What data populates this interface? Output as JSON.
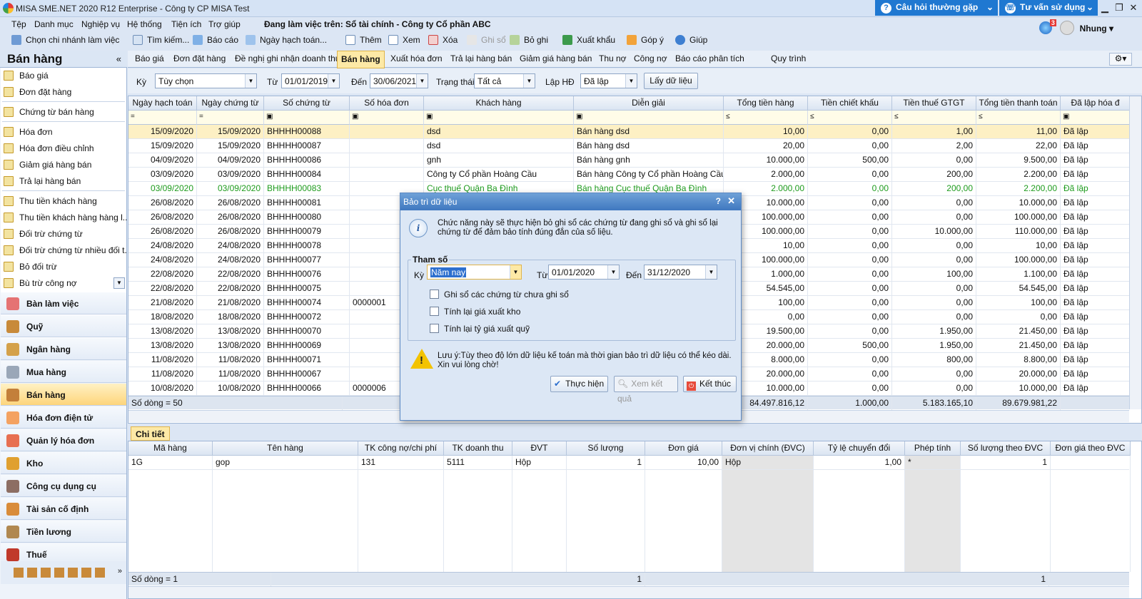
{
  "window": {
    "title": "MISA SME.NET 2020 R12 Enterprise - Công ty CP MISA Test",
    "faq": "Câu hỏi thường gặp",
    "consult": "Tư vấn sử dụng"
  },
  "menu": [
    "Tệp",
    "Danh mục",
    "Nghiệp vụ",
    "Hệ thống",
    "Tiện ích",
    "Trợ giúp"
  ],
  "working_on": "Đang làm việc trên: Sổ tài chính - Công ty Cổ phần ABC",
  "toolbar": {
    "branch": "Chọn chi nhánh làm việc",
    "search": "Tìm kiếm...",
    "report": "Báo cáo",
    "post_date": "Ngày hạch toán...",
    "add": "Thêm",
    "view": "Xem",
    "delete": "Xóa",
    "post": "Ghi sổ",
    "unpost": "Bỏ ghi",
    "export": "Xuất khẩu",
    "feedback": "Góp ý",
    "help": "Giúp"
  },
  "user": {
    "name": "Nhung",
    "badge": "3"
  },
  "left": {
    "title": "Bán hàng",
    "items": [
      "Báo giá",
      "Đơn đặt hàng",
      "Chứng từ bán hàng",
      "Hóa đơn",
      "Hóa đơn điều chỉnh",
      "Giảm giá hàng bán",
      "Trả lại hàng bán",
      "Thu tiền khách hàng",
      "Thu tiền khách hàng hàng l...",
      "Đối trừ chứng từ",
      "Đối trừ chứng từ nhiều đối t...",
      "Bỏ đối trừ",
      "Bù trừ công nợ"
    ],
    "modules": [
      "Bàn làm việc",
      "Quỹ",
      "Ngân hàng",
      "Mua hàng",
      "Bán hàng",
      "Hóa đơn điện tử",
      "Quản lý hóa đơn",
      "Kho",
      "Công cụ dụng cụ",
      "Tài sản cố định",
      "Tiền lương",
      "Thuế"
    ]
  },
  "tabs": [
    "Báo giá",
    "Đơn đặt hàng",
    "Đề nghị ghi nhận doanh thu",
    "Bán hàng",
    "Xuất hóa đơn",
    "Trả lại hàng bán",
    "Giảm giá hàng bán",
    "Thu nợ",
    "Công nợ",
    "Báo cáo phân tích",
    "Quy trình"
  ],
  "filter": {
    "ky_label": "Kỳ",
    "ky": "Tùy chọn",
    "tu_label": "Từ",
    "tu": "01/01/2019",
    "den_label": "Đến",
    "den": "30/06/2021",
    "status_label": "Trạng thái",
    "status": "Tất cả",
    "lap_label": "Lập HĐ",
    "lap": "Đã lập",
    "fetch": "Lấy dữ liệu"
  },
  "grid": {
    "headers": [
      "Ngày hạch toán",
      "Ngày chứng từ",
      "Số chứng từ",
      "Số hóa đơn",
      "Khách hàng",
      "Diễn giải",
      "Tổng tiền hàng",
      "Tiền chiết khấu",
      "Tiền thuế GTGT",
      "Tổng tiền thanh toán",
      "Đã lập hóa đ"
    ],
    "rows": [
      [
        "15/09/2020",
        "15/09/2020",
        "BHHHH00088",
        "",
        "dsd",
        "Bán hàng dsd",
        "10,00",
        "0,00",
        "1,00",
        "11,00",
        "Đã lập"
      ],
      [
        "15/09/2020",
        "15/09/2020",
        "BHHHH00087",
        "",
        "dsd",
        "Bán hàng dsd",
        "20,00",
        "0,00",
        "2,00",
        "22,00",
        "Đã lập"
      ],
      [
        "04/09/2020",
        "04/09/2020",
        "BHHHH00086",
        "",
        "gnh",
        "Bán hàng gnh",
        "10.000,00",
        "500,00",
        "0,00",
        "9.500,00",
        "Đã lập"
      ],
      [
        "03/09/2020",
        "03/09/2020",
        "BHHHH00084",
        "",
        "Công ty Cổ phần Hoàng Cầu",
        "Bán hàng Công ty Cổ phần Hoàng Cầu",
        "2.000,00",
        "0,00",
        "200,00",
        "2.200,00",
        "Đã lập"
      ],
      [
        "03/09/2020",
        "03/09/2020",
        "BHHHH00083",
        "",
        "Cục thuế Quận Ba Đình",
        "Bán hàng Cục thuế Quận Ba Đình",
        "2.000,00",
        "0,00",
        "200,00",
        "2.200,00",
        "Đã lập"
      ],
      [
        "26/08/2020",
        "26/08/2020",
        "BHHHH00081",
        "",
        "",
        "",
        "10.000,00",
        "0,00",
        "0,00",
        "10.000,00",
        "Đã lập"
      ],
      [
        "26/08/2020",
        "26/08/2020",
        "BHHHH00080",
        "",
        "",
        "",
        "100.000,00",
        "0,00",
        "0,00",
        "100.000,00",
        "Đã lập"
      ],
      [
        "26/08/2020",
        "26/08/2020",
        "BHHHH00079",
        "",
        "",
        "",
        "100.000,00",
        "0,00",
        "10.000,00",
        "110.000,00",
        "Đã lập"
      ],
      [
        "24/08/2020",
        "24/08/2020",
        "BHHHH00078",
        "",
        "",
        "",
        "10,00",
        "0,00",
        "0,00",
        "10,00",
        "Đã lập"
      ],
      [
        "24/08/2020",
        "24/08/2020",
        "BHHHH00077",
        "",
        "",
        "",
        "100.000,00",
        "0,00",
        "0,00",
        "100.000,00",
        "Đã lập"
      ],
      [
        "22/08/2020",
        "22/08/2020",
        "BHHHH00076",
        "",
        "",
        "",
        "1.000,00",
        "0,00",
        "100,00",
        "1.100,00",
        "Đã lập"
      ],
      [
        "22/08/2020",
        "22/08/2020",
        "BHHHH00075",
        "",
        "",
        "",
        "54.545,00",
        "0,00",
        "0,00",
        "54.545,00",
        "Đã lập"
      ],
      [
        "21/08/2020",
        "21/08/2020",
        "BHHHH00074",
        "0000001",
        "",
        "",
        "100,00",
        "0,00",
        "0,00",
        "100,00",
        "Đã lập"
      ],
      [
        "18/08/2020",
        "18/08/2020",
        "BHHHH00072",
        "",
        "",
        "",
        "0,00",
        "0,00",
        "0,00",
        "0,00",
        "Đã lập"
      ],
      [
        "13/08/2020",
        "13/08/2020",
        "BHHHH00070",
        "",
        "",
        "",
        "19.500,00",
        "0,00",
        "1.950,00",
        "21.450,00",
        "Đã lập"
      ],
      [
        "13/08/2020",
        "13/08/2020",
        "BHHHH00069",
        "",
        "",
        "",
        "20.000,00",
        "500,00",
        "1.950,00",
        "21.450,00",
        "Đã lập"
      ],
      [
        "11/08/2020",
        "11/08/2020",
        "BHHHH00071",
        "",
        "",
        "",
        "8.000,00",
        "0,00",
        "800,00",
        "8.800,00",
        "Đã lập"
      ],
      [
        "11/08/2020",
        "11/08/2020",
        "BHHHH00067",
        "",
        "",
        "",
        "20.000,00",
        "0,00",
        "0,00",
        "20.000,00",
        "Đã lập"
      ],
      [
        "10/08/2020",
        "10/08/2020",
        "BHHHH00066",
        "0000006",
        "",
        "",
        "10.000,00",
        "0,00",
        "0,00",
        "10.000,00",
        "Đã lập"
      ]
    ],
    "footer": {
      "count": "Số dòng = 50",
      "total": "84.497.816,12",
      "discount": "1.000,00",
      "vat": "5.183.165,10",
      "pay": "89.679.981,22"
    }
  },
  "detail": {
    "tab": "Chi tiết",
    "headers": [
      "Mã hàng",
      "Tên hàng",
      "TK công nợ/chi phí",
      "TK doanh thu",
      "ĐVT",
      "Số lượng",
      "Đơn giá",
      "Đơn vị chính (ĐVC)",
      "Tỷ lệ chuyển đổi",
      "Phép tính",
      "Số lượng theo ĐVC",
      "Đơn giá theo ĐVC"
    ],
    "row": [
      "1G",
      "gop",
      "131",
      "5111",
      "Hộp",
      "1",
      "10,00",
      "Hộp",
      "1,00",
      "*",
      "1",
      ""
    ],
    "footer": {
      "count": "Số dòng = 1",
      "qty": "1",
      "qty2": "1"
    }
  },
  "dialog": {
    "title": "Bảo trì dữ liệu",
    "info": "Chức năng này sẽ thực hiện bỏ ghi sổ các chứng từ đang ghi sổ và ghi sổ lại chứng từ để đảm bảo tính đúng đắn của số liệu.",
    "group": "Tham số",
    "ky_label": "Kỳ",
    "ky": "Năm nay",
    "tu_label": "Từ",
    "tu": "01/01/2020",
    "den_label": "Đến",
    "den": "31/12/2020",
    "opt1": "Ghi sổ các chứng từ chưa ghi sổ",
    "opt2": "Tính lại giá xuất kho",
    "opt3": "Tính lại tỷ giá xuất quỹ",
    "note1": "Lưu ý:Tùy theo độ lớn dữ liệu kế toán mà thời gian bảo trì dữ liệu có thể kéo dài.",
    "note2": "Xin vui lòng chờ!",
    "run": "Thực hiện",
    "view": "Xem kết quả",
    "close": "Kết thúc"
  }
}
